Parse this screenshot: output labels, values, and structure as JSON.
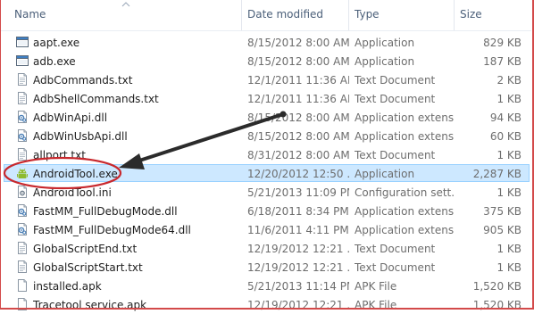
{
  "columns": {
    "name": "Name",
    "date": "Date modified",
    "type": "Type",
    "size": "Size"
  },
  "files": [
    {
      "name": "aapt.exe",
      "date": "8/15/2012 8:00 AM",
      "type": "Application",
      "size": "829 KB",
      "icon": "exe-window-icon"
    },
    {
      "name": "adb.exe",
      "date": "8/15/2012 8:00 AM",
      "type": "Application",
      "size": "187 KB",
      "icon": "exe-window-icon"
    },
    {
      "name": "AdbCommands.txt",
      "date": "12/1/2011 11:36 AM",
      "type": "Text Document",
      "size": "2 KB",
      "icon": "text-file-icon"
    },
    {
      "name": "AdbShellCommands.txt",
      "date": "12/1/2011 11:36 AM",
      "type": "Text Document",
      "size": "1 KB",
      "icon": "text-file-icon"
    },
    {
      "name": "AdbWinApi.dll",
      "date": "8/15/2012 8:00 AM",
      "type": "Application extens...",
      "size": "94 KB",
      "icon": "dll-file-icon"
    },
    {
      "name": "AdbWinUsbApi.dll",
      "date": "8/15/2012 8:00 AM",
      "type": "Application extens...",
      "size": "60 KB",
      "icon": "dll-file-icon"
    },
    {
      "name": "allport.txt",
      "date": "8/31/2012 8:00 AM",
      "type": "Text Document",
      "size": "1 KB",
      "icon": "text-file-icon"
    },
    {
      "name": "AndroidTool.exe",
      "date": "12/20/2012 12:50 ...",
      "type": "Application",
      "size": "2,287 KB",
      "icon": "android-app-icon",
      "selected": true
    },
    {
      "name": "AndroidTool.ini",
      "date": "5/21/2013 11:09 PM",
      "type": "Configuration sett...",
      "size": "1 KB",
      "icon": "config-file-icon"
    },
    {
      "name": "FastMM_FullDebugMode.dll",
      "date": "6/18/2011 8:34 PM",
      "type": "Application extens...",
      "size": "375 KB",
      "icon": "dll-file-icon"
    },
    {
      "name": "FastMM_FullDebugMode64.dll",
      "date": "11/6/2011 4:11 PM",
      "type": "Application extens...",
      "size": "905 KB",
      "icon": "dll-file-icon"
    },
    {
      "name": "GlobalScriptEnd.txt",
      "date": "12/19/2012 12:21 ...",
      "type": "Text Document",
      "size": "1 KB",
      "icon": "text-file-icon"
    },
    {
      "name": "GlobalScriptStart.txt",
      "date": "12/19/2012 12:21 ...",
      "type": "Text Document",
      "size": "1 KB",
      "icon": "text-file-icon"
    },
    {
      "name": "installed.apk",
      "date": "5/21/2013 11:14 PM",
      "type": "APK File",
      "size": "1,520 KB",
      "icon": "apk-file-icon"
    },
    {
      "name": "Tracetool service.apk",
      "date": "12/19/2012 12:21 ...",
      "type": "APK File",
      "size": "1,520 KB",
      "icon": "apk-file-icon"
    }
  ],
  "colors": {
    "selection_fill": "#cde8ff",
    "selection_border": "#99d1ff",
    "annotation_red": "#c8282d",
    "arrow": "#2b2b2b"
  }
}
